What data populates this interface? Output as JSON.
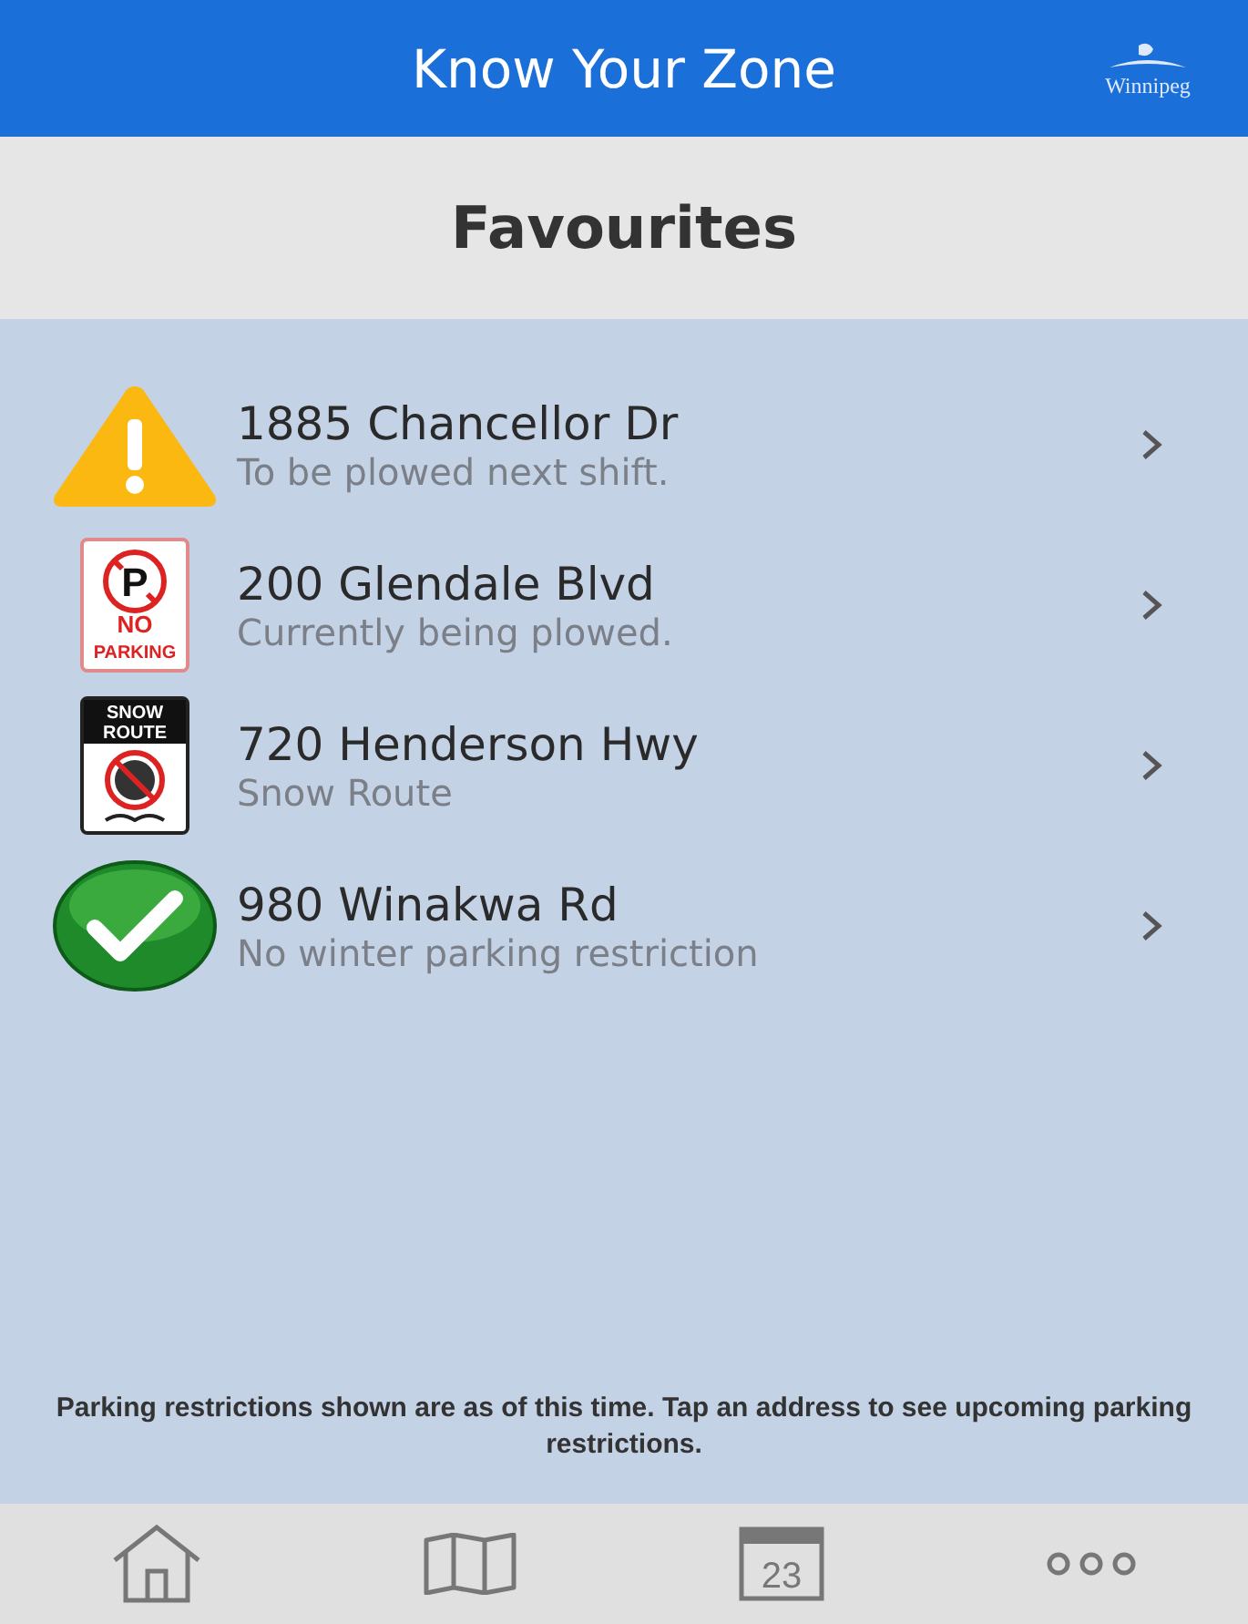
{
  "header": {
    "title": "Know Your Zone",
    "logo_text": "Winnipeg"
  },
  "page_title": "Favourites",
  "favourites": [
    {
      "kind": "warning",
      "address": "1885 Chancellor Dr",
      "status": "To be plowed next shift."
    },
    {
      "kind": "no_parking",
      "address": "200 Glendale Blvd",
      "status": "Currently being plowed.",
      "sign_symbol": "P",
      "sign_text": [
        "NO",
        "PARKING"
      ]
    },
    {
      "kind": "snow_route",
      "address": "720 Henderson Hwy",
      "status": "Snow Route",
      "sign_text": [
        "SNOW",
        "ROUTE"
      ]
    },
    {
      "kind": "ok",
      "address": "980 Winakwa Rd",
      "status": "No winter parking restriction"
    }
  ],
  "note": "Parking restrictions shown are as of this time. Tap an address to see upcoming parking restrictions.",
  "nav": [
    {
      "kind": "home"
    },
    {
      "kind": "map"
    },
    {
      "kind": "calendar",
      "label": "23"
    },
    {
      "kind": "more"
    }
  ]
}
